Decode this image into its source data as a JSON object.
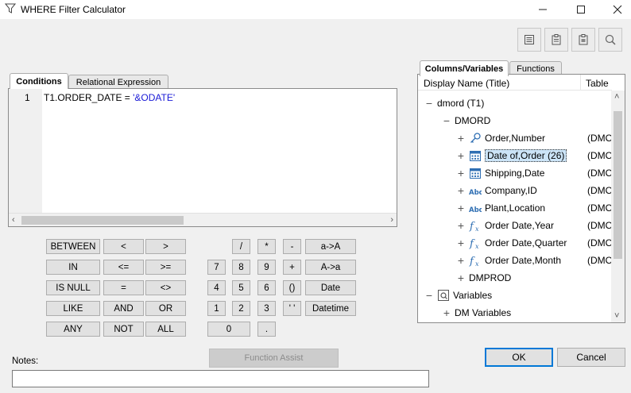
{
  "window": {
    "title": "WHERE Filter Calculator",
    "minimize_glyph": "—",
    "close_glyph": "✕"
  },
  "left_tabs": [
    "Conditions",
    "Relational Expression"
  ],
  "editor": {
    "line_number": "1",
    "code_prefix": "T1.ORDER_DATE = ",
    "code_string": "'&ODATE'"
  },
  "operators": {
    "col1": [
      "BETWEEN",
      "IN",
      "IS NULL",
      "LIKE",
      "ANY"
    ],
    "col2": [
      "<",
      "<=",
      "=",
      "AND",
      "NOT"
    ],
    "col3": [
      ">",
      ">=",
      "<>",
      "OR",
      "ALL"
    ],
    "row1": [
      "/",
      "*",
      "-",
      "a->A"
    ],
    "row2": [
      "7",
      "8",
      "9",
      "+",
      "A->a"
    ],
    "row3": [
      "4",
      "5",
      "6",
      "()",
      "Date"
    ],
    "row4": [
      "1",
      "2",
      "3",
      "' '",
      "Datetime"
    ],
    "row5": [
      "0",
      "."
    ]
  },
  "right_tabs": [
    "Columns/Variables",
    "Functions"
  ],
  "tree": {
    "headers": [
      "Display Name (Title)",
      "Table"
    ],
    "root": "dmord (T1)",
    "segment": "DMORD",
    "fields": [
      {
        "label": "Order,Number",
        "table": "(DMO",
        "icon": "key-icon"
      },
      {
        "label": "Date of,Order (26)",
        "table": "(DMO",
        "icon": "calendar-icon",
        "selected": true
      },
      {
        "label": "Shipping,Date",
        "table": "(DMO",
        "icon": "calendar-icon"
      },
      {
        "label": "Company,ID",
        "table": "(DMO",
        "icon": "abc-icon"
      },
      {
        "label": "Plant,Location",
        "table": "(DMO",
        "icon": "abc-icon"
      },
      {
        "label": "Order Date,Year",
        "table": "(DMO",
        "icon": "function-icon"
      },
      {
        "label": "Order Date,Quarter",
        "table": "(DMO",
        "icon": "function-icon"
      },
      {
        "label": "Order Date,Month",
        "table": "(DMO",
        "icon": "function-icon"
      }
    ],
    "dmprod": "DMPROD",
    "variables": "Variables",
    "dm_variables": "DM Variables"
  },
  "bottom": {
    "function_assist": "Function Assist",
    "notes_label": "Notes:",
    "notes_value": "",
    "ok": "OK",
    "cancel": "Cancel"
  },
  "colors": {
    "accent": "#0078d7",
    "string_literal": "#1a1ad6",
    "icon_blue": "#2f6fb3"
  }
}
